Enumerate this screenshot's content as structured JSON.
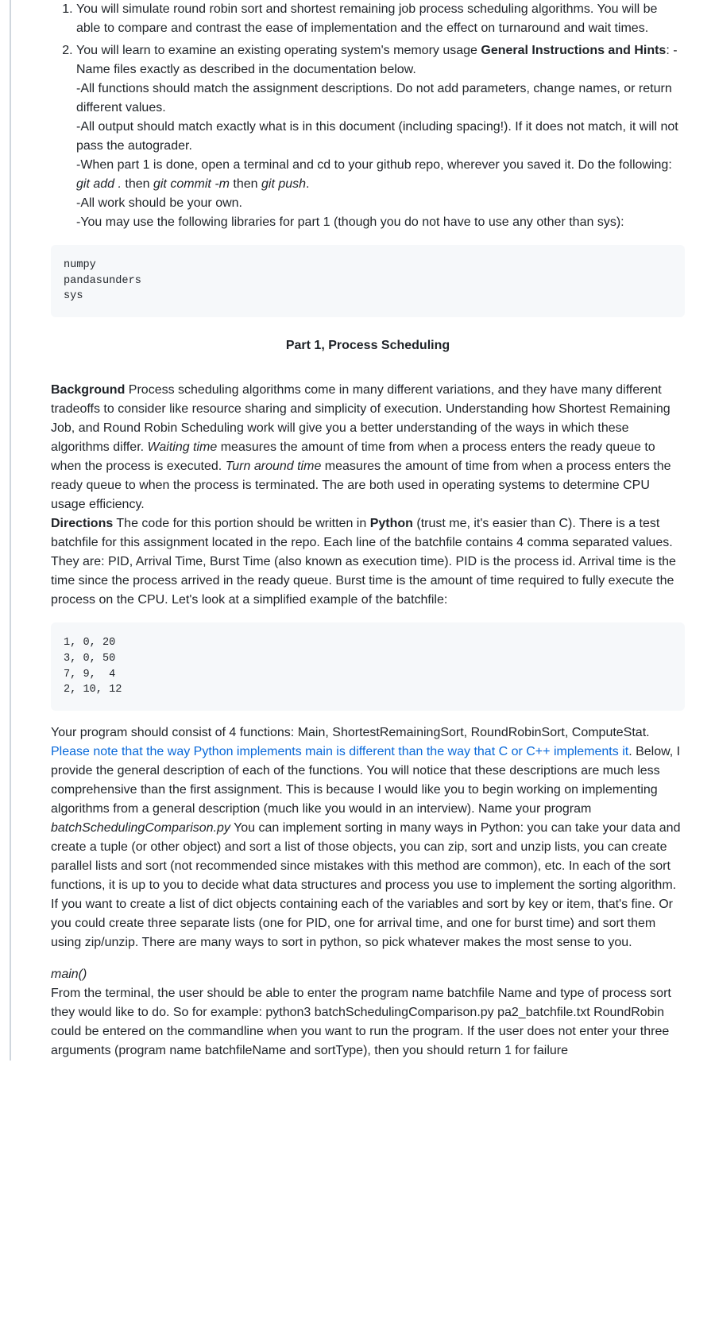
{
  "list": {
    "item1": "You will simulate round robin sort and shortest remaining job process scheduling algorithms. You will be able to compare and contrast the ease of implementation and the effect on turnaround and wait times.",
    "item2": {
      "lead": "You will learn to examine an existing operating system's memory usage ",
      "bold": "General Instructions and Hints",
      "after_bold": ": -Name files exactly as described in the documentation below.",
      "line2": "-All functions should match the assignment descriptions. Do not add parameters, change names, or return different values.",
      "line3": "-All output should match exactly what is in this document (including spacing!). If it does not match, it will not pass the autograder.",
      "line4a": "-When part 1 is done, open a terminal and cd to your github repo, wherever you saved it. Do the following: ",
      "gitadd": "git add .",
      "then1": " then ",
      "gitcommit": "git commit -m",
      "then2": " then ",
      "gitpush": "git push",
      "period": ".",
      "line5": "-All work should be your own.",
      "line6": "-You may use the following libraries for part 1 (though you do not have to use any other than sys):"
    }
  },
  "code1": "numpy\npandasunders\nsys",
  "heading": "Part 1, Process Scheduling",
  "background": {
    "bold": "Background",
    "text1": " Process scheduling algorithms come in many different variations, and they have many different tradeoffs to consider like resource sharing and simplicity of execution. Understanding how Shortest Remaining Job, and Round Robin Scheduling work will give you a better understanding of the ways in which these algorithms differ. ",
    "waiting": "Waiting time",
    "text2": " measures the amount of time from when a process enters the ready queue to when the process is executed. ",
    "turnaround": "Turn around time",
    "text3": " measures the amount of time from when a process enters the ready queue to when the process is terminated. The are both used in operating systems to determine CPU usage efficiency."
  },
  "directions": {
    "bold": "Directions",
    "text1": " The code for this portion should be written in ",
    "python": "Python",
    "text2": " (trust me, it's easier than C). There is a test batchfile for this assignment located in the repo. Each line of the batchfile contains 4 comma separated values. They are: PID, Arrival Time, Burst Time (also known as execution time). PID is the process id. Arrival time is the time since the process arrived in the ready queue. Burst time is the amount of time required to fully execute the process on the CPU. Let's look at a simplified example of the batchfile:"
  },
  "code2": "1, 0, 20\n3, 0, 50\n7, 9,  4\n2, 10, 12",
  "functions": {
    "text1": "Your program should consist of 4 functions: Main, ShortestRemainingSort, RoundRobinSort, ComputeStat. ",
    "link": "Please note that the way Python implements main is different than the way that C or C++ implements it",
    "text2": ". Below, I provide the general description of each of the functions. You will notice that these descriptions are much less comprehensive than the first assignment. This is because I would like you to begin working on implementing algorithms from a general description (much like you would in an interview). Name your program ",
    "filename": "batchSchedulingComparison.py",
    "text3": " You can implement sorting in many ways in Python: you can take your data and create a tuple (or other object) and sort a list of those objects, you can zip, sort and unzip lists, you can create parallel lists and sort (not recommended since mistakes with this method are common), etc. In each of the sort functions, it is up to you to decide what data structures and process you use to implement the sorting algorithm. If you want to create a list of dict objects containing each of the variables and sort by key or item, that's fine. Or you could create three separate lists (one for PID, one for arrival time, and one for burst time) and sort them using zip/unzip. There are many ways to sort in python, so pick whatever makes the most sense to you."
  },
  "main": {
    "title": "main()",
    "text": "From the terminal, the user should be able to enter the program name batchfile Name and type of process sort they would like to do. So for example: python3 batchSchedulingComparison.py pa2_batchfile.txt RoundRobin could be entered on the commandline when you want to run the program. If the user does not enter your three arguments (program name batchfileName and sortType), then you should return 1 for failure"
  }
}
